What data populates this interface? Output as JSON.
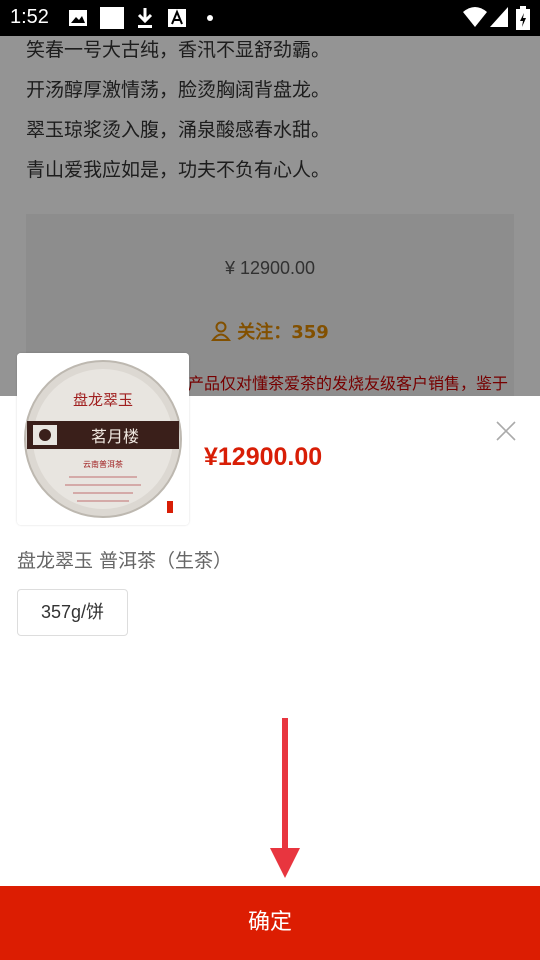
{
  "status_bar": {
    "time": "1:52"
  },
  "background": {
    "poem_lines": [
      "笑春一号大古纯，香汛不显舒劲霸。",
      "开汤醇厚激情荡，脸烫胸阔背盘龙。",
      "翠玉琼浆烫入腹，涌泉酸感春水甜。",
      "青山爱我应如是，功夫不负有心人。"
    ],
    "price": "¥ 12900.00",
    "follow_label": "关注：359",
    "notice": "产品仅对懂茶爱茶的发烧友级客户销售，鉴于"
  },
  "sheet": {
    "price": "¥12900.00",
    "product_name": "盘龙翠玉 普洱茶（生茶）",
    "spec": "357g/饼",
    "confirm_label": "确定",
    "tea_cake": {
      "title": "盘龙翠玉",
      "brand": "茗月楼",
      "subtitle": "云南普洱茶"
    }
  },
  "colors": {
    "accent": "#dc1d02",
    "price": "#d81e06",
    "follow": "#e08a00",
    "arrow": "#e8353f"
  }
}
